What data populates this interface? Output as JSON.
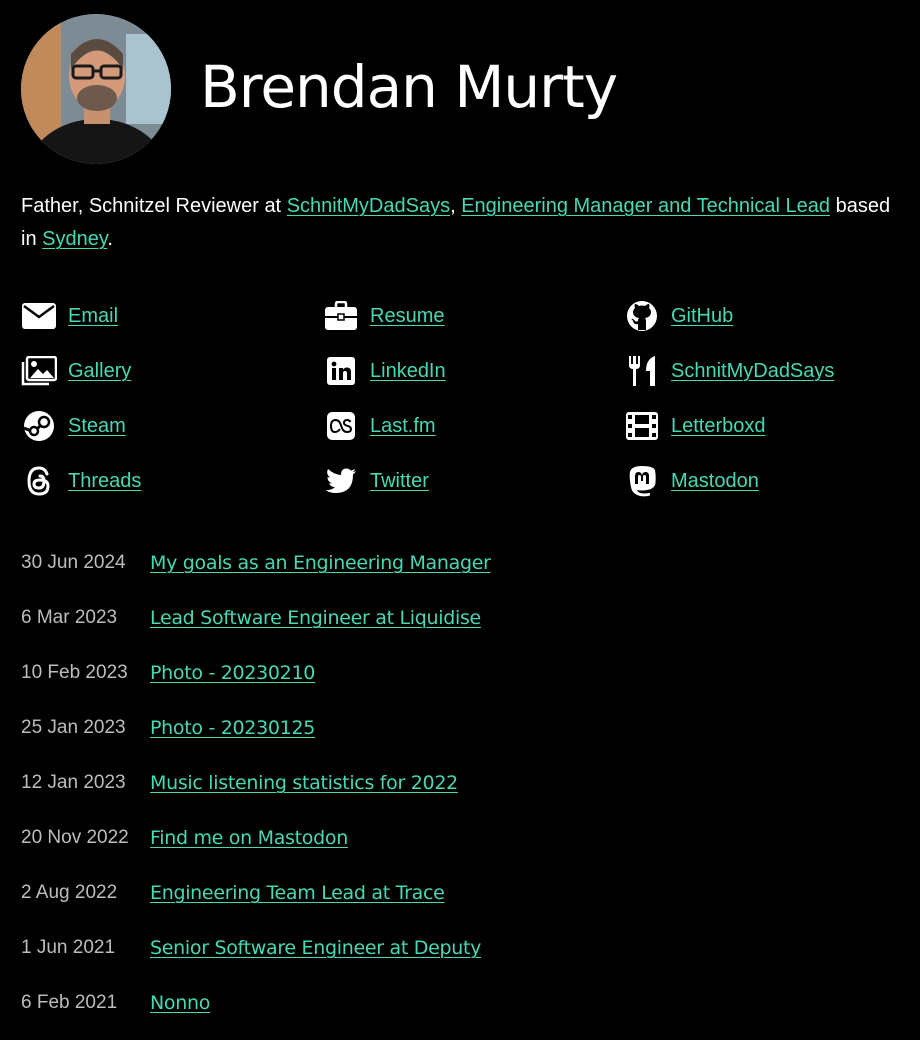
{
  "profile": {
    "name": "Brendan Murty"
  },
  "bio": {
    "part1": "Father, Schnitzel Reviewer at ",
    "link1": "SchnitMyDadSays",
    "part2": ", ",
    "link2": "Engineering Manager and Technical Lead",
    "part3": " based in ",
    "link3": "Sydney",
    "part4": "."
  },
  "links": [
    {
      "label": "Email",
      "icon": "envelope-icon"
    },
    {
      "label": "Resume",
      "icon": "briefcase-icon"
    },
    {
      "label": "GitHub",
      "icon": "github-icon"
    },
    {
      "label": "Gallery",
      "icon": "images-icon"
    },
    {
      "label": "LinkedIn",
      "icon": "linkedin-icon"
    },
    {
      "label": "SchnitMyDadSays",
      "icon": "utensils-icon"
    },
    {
      "label": "Steam",
      "icon": "steam-icon"
    },
    {
      "label": "Last.fm",
      "icon": "lastfm-icon"
    },
    {
      "label": "Letterboxd",
      "icon": "film-icon"
    },
    {
      "label": "Threads",
      "icon": "threads-icon"
    },
    {
      "label": "Twitter",
      "icon": "twitter-icon"
    },
    {
      "label": "Mastodon",
      "icon": "mastodon-icon"
    }
  ],
  "posts": [
    {
      "date": "30 Jun 2024",
      "title": "My goals as an Engineering Manager"
    },
    {
      "date": "6 Mar 2023",
      "title": "Lead Software Engineer at Liquidise"
    },
    {
      "date": "10 Feb 2023",
      "title": "Photo - 20230210"
    },
    {
      "date": "25 Jan 2023",
      "title": "Photo - 20230125"
    },
    {
      "date": "12 Jan 2023",
      "title": "Music listening statistics for 2022"
    },
    {
      "date": "20 Nov 2022",
      "title": "Find me on Mastodon"
    },
    {
      "date": "2 Aug 2022",
      "title": "Engineering Team Lead at Trace"
    },
    {
      "date": "1 Jun 2021",
      "title": "Senior Software Engineer at Deputy"
    },
    {
      "date": "6 Feb 2021",
      "title": "Nonno"
    }
  ],
  "colors": {
    "background": "#000000",
    "text": "#ffffff",
    "link": "#48d8b4",
    "date": "#bdbdbd"
  }
}
